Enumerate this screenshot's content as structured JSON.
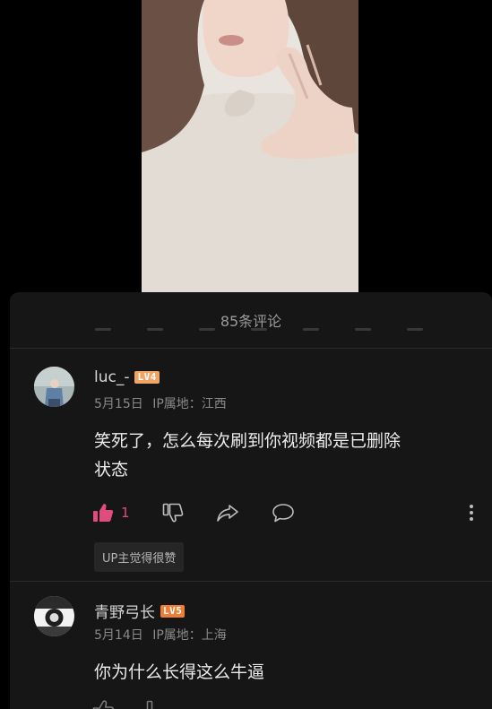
{
  "panel": {
    "comment_count_label": "85条评论"
  },
  "comments": [
    {
      "username": "luc_-",
      "level": "LV4",
      "date": "5月15日",
      "ip_label": "IP属地：",
      "ip_location": "江西",
      "text_line1": "笑死了，怎么每次刷到你视频都是已删除",
      "text_line2": "状态",
      "like_count": "1",
      "up_tag": "UP主觉得很赞"
    },
    {
      "username": "青野弓长",
      "level": "LV5",
      "date": "5月14日",
      "ip_label": "IP属地：",
      "ip_location": "上海",
      "text_line1": "你为什么长得这么牛逼"
    }
  ],
  "colors": {
    "like_active": "#e14c7e",
    "lv4": "#f1a564",
    "lv5": "#ee7d35",
    "panel_bg": "#161616"
  },
  "icons": [
    "thumbs-up-icon",
    "thumbs-down-icon",
    "share-icon",
    "reply-icon",
    "more-vertical-icon"
  ]
}
